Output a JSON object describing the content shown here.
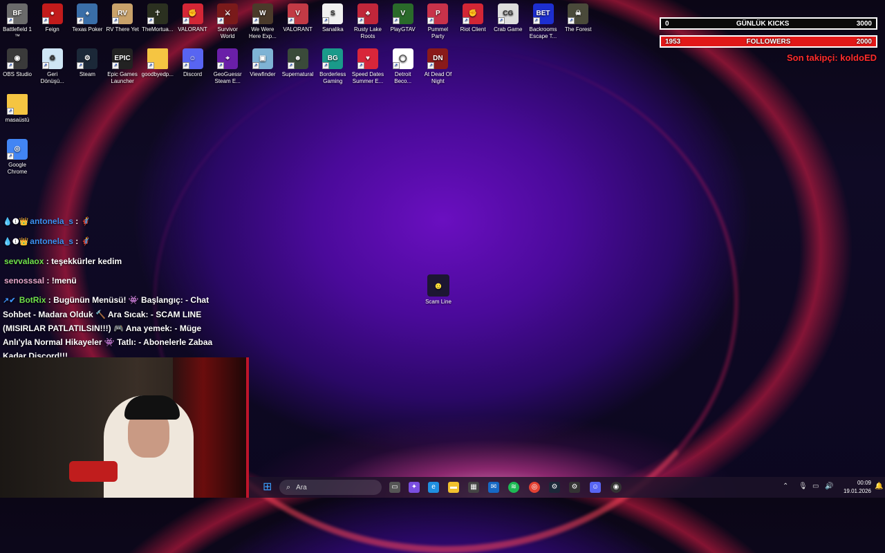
{
  "desktop_icons": [
    {
      "label": "Battlefield 1 ™",
      "icon": "battlefield-icon",
      "color": "#6b6b6b",
      "glyph": "BF"
    },
    {
      "label": "Feign",
      "icon": "feign-icon",
      "color": "#c21b1b",
      "glyph": "●"
    },
    {
      "label": "Texas Poker",
      "icon": "texas-poker-icon",
      "color": "#3a6ea8",
      "glyph": "♠"
    },
    {
      "label": "RV There Yet",
      "icon": "rv-there-yet-icon",
      "color": "#c9a26a",
      "glyph": "RV"
    },
    {
      "label": "TheMortua...",
      "icon": "mortuary-icon",
      "color": "#2b3020",
      "glyph": "☥"
    },
    {
      "label": "VALORANT",
      "icon": "riot-icon",
      "color": "#d32635",
      "glyph": "✊"
    },
    {
      "label": "Survivor World",
      "icon": "survivor-world-icon",
      "color": "#7a1a1a",
      "glyph": "⚔"
    },
    {
      "label": "We Were Here Exp...",
      "icon": "we-were-here-icon",
      "color": "#4a3a2a",
      "glyph": "W"
    },
    {
      "label": "VALORANT",
      "icon": "valorant-icon",
      "color": "#c23a45",
      "glyph": "V"
    },
    {
      "label": "Sanalika",
      "icon": "sanalika-icon",
      "color": "#f0f0f0",
      "glyph": "S"
    },
    {
      "label": "Rusty Lake Roots",
      "icon": "rusty-lake-icon",
      "color": "#c0263a",
      "glyph": "♣"
    },
    {
      "label": "PlayGTAV",
      "icon": "gta-icon",
      "color": "#2a6a2a",
      "glyph": "V"
    },
    {
      "label": "Pummel Party",
      "icon": "pummel-party-icon",
      "color": "#c8324a",
      "glyph": "P"
    },
    {
      "label": "Riot Client",
      "icon": "riot-client-icon",
      "color": "#d32635",
      "glyph": "✊"
    },
    {
      "label": "Crab Game",
      "icon": "crab-game-icon",
      "color": "#ddd",
      "glyph": "CG"
    },
    {
      "label": "Backrooms Escape T...",
      "icon": "backrooms-icon",
      "color": "#1d2fd0",
      "glyph": "BET"
    },
    {
      "label": "The Forest",
      "icon": "the-forest-icon",
      "color": "#4a4a3a",
      "glyph": "☠"
    },
    {
      "label": "OBS Studio",
      "icon": "obs-icon",
      "color": "#3a3a3a",
      "glyph": "◉"
    },
    {
      "label": "Geri Dönüşü...",
      "icon": "recycle-bin-icon",
      "color": "#cfe6f5",
      "glyph": "♻"
    },
    {
      "label": "Steam",
      "icon": "steam-icon",
      "color": "#1b2838",
      "glyph": "⚙"
    },
    {
      "label": "Epic Games Launcher",
      "icon": "epic-games-icon",
      "color": "#222",
      "glyph": "EPIC"
    },
    {
      "label": "goodbyedp...",
      "icon": "folder-icon",
      "color": "#f5c542",
      "glyph": ""
    },
    {
      "label": "Discord",
      "icon": "discord-icon",
      "color": "#5865f2",
      "glyph": "☺"
    },
    {
      "label": "GeoGuessr Steam E...",
      "icon": "geoguessr-icon",
      "color": "#6a1fa8",
      "glyph": "⌖"
    },
    {
      "label": "Viewfinder",
      "icon": "viewfinder-icon",
      "color": "#7fb3d5",
      "glyph": "▣"
    },
    {
      "label": "Supernatural",
      "icon": "supernatural-icon",
      "color": "#3a4a3a",
      "glyph": "☻"
    },
    {
      "label": "Borderless Gaming",
      "icon": "borderless-gaming-icon",
      "color": "#1a9a8a",
      "glyph": "BG"
    },
    {
      "label": "Speed Dates Summer E...",
      "icon": "speed-dates-icon",
      "color": "#d8263a",
      "glyph": "♥"
    },
    {
      "label": "Detroit Beco...",
      "icon": "detroit-icon",
      "color": "#fff",
      "glyph": "◯"
    },
    {
      "label": "At Dead Of Night",
      "icon": "at-dead-of-night-icon",
      "color": "#8a1a1a",
      "glyph": "DN"
    },
    {
      "label": "masaüstü",
      "icon": "folder-icon",
      "color": "#f5c542",
      "glyph": ""
    },
    {
      "label": "Google Chrome",
      "icon": "chrome-icon",
      "color": "#4285f4",
      "glyph": "◎"
    }
  ],
  "center_icon": {
    "label": "Scam Line",
    "icon": "scam-line-icon"
  },
  "stream_overlay": {
    "kicks": {
      "current": "0",
      "title": "GÜNLÜK KICKS",
      "goal": "3000"
    },
    "followers": {
      "current": "1953",
      "title": "FOLLOWERS",
      "goal": "2000"
    },
    "last_follower": "Son takipçi: koldoED"
  },
  "chat": [
    {
      "badges": "💧❶👑",
      "user": "antonela_s",
      "sep": " : ",
      "message": "🦸",
      "color": "blue"
    },
    {
      "badges": "💧❶👑",
      "user": "antonela_s",
      "sep": " : ",
      "message": "🦸",
      "color": "blue"
    },
    {
      "badges": "",
      "user": "sevvalaox",
      "sep": " : ",
      "message": "teşekkürler kedim",
      "color": "green"
    },
    {
      "badges": "",
      "user": "senosssal",
      "sep": " : ",
      "message": "!menü",
      "color": "pink"
    }
  ],
  "bot": {
    "badges": "↗✔",
    "user": "BotRix",
    "message": ": Bugünün Menüsü! 👾 Başlangıç: - Chat Sohbet - Madara Olduk 🔨 Ara Sıcak: - SCAM LINE (MISIRLAR PATLATILSIN!!!) 🎮 Ana yemek: - Müge Anlı'yla Normal Hikayeler 👾 Tatlı: - Abonelerle Zabaa Kadar Discord!!!"
  },
  "taskbar": {
    "search_placeholder": "Ara",
    "time": "00:09",
    "date": "19.01.2026"
  }
}
